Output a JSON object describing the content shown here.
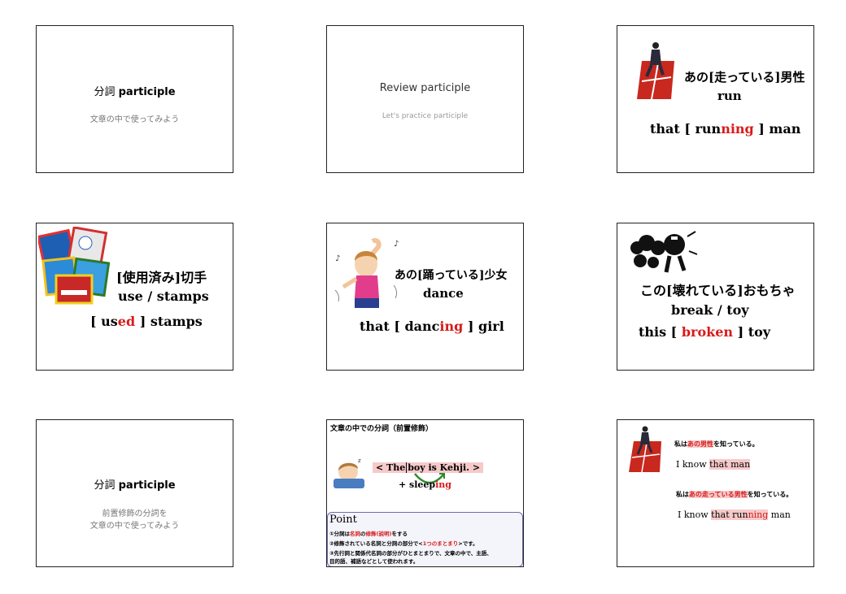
{
  "slides": {
    "s1": {
      "title_jp": "分詞",
      "title_en": "participle",
      "subtitle": "文章の中で使ってみよう"
    },
    "s2": {
      "title": "Review participle",
      "subtitle": "Let's practice participle"
    },
    "s3": {
      "jp": "あの[走っている]男性",
      "word": "run",
      "ph_a": "that [  run",
      "ph_b": "ning",
      "ph_c": "  ] man"
    },
    "s4": {
      "jp": "[使用済み]切手",
      "words": "use /  stamps",
      "ph_a": "[  us",
      "ph_b": "ed",
      "ph_c": "  ] stamps"
    },
    "s5": {
      "jp": "あの[踊っている]少女",
      "word": "dance",
      "ph_a": "that [  danc",
      "ph_b": "ing",
      "ph_c": "  ] girl"
    },
    "s6": {
      "jp": "この[壊れている]おもちゃ",
      "words": "break  / toy",
      "ph_a": "this [  ",
      "ph_b": "broken",
      "ph_c": "  ] toy"
    },
    "s7": {
      "title_jp": "分詞",
      "title_en": "participle",
      "sub1": "前置修飾の分詞を",
      "sub2": "文章の中で使ってみよう"
    },
    "s8": {
      "heading": "文章の中での分詞（前置修飾）",
      "sentence_a": "< The",
      "sentence_b": "boy   is Kehji.",
      "sentence_c": " >",
      "add_a": "+ sleep",
      "add_b": "ing",
      "point_title": "Point",
      "p1_a": "①分詞は",
      "p1_b": "名詞",
      "p1_c": "の",
      "p1_d": "修飾(説明)",
      "p1_e": "をする",
      "p2_a": "②修飾されている名詞と分詞の部分で<",
      "p2_b": "1つのまとまり",
      "p2_c": ">です。",
      "p3": "③先行詞と関係代名詞の部分がひとまとまりで、文章の中で、主語、",
      "p4": "  目的語、補語などとして使われます。"
    },
    "s9": {
      "l1_a": "私は",
      "l1_b": "あの男性",
      "l1_c": "を知っている。",
      "l2_a": "I know ",
      "l2_b": "that man",
      "l3_a": "私は",
      "l3_b": "あの走っている男性",
      "l3_c": "を知っている。",
      "l4_a": "I know ",
      "l4_b": "that run",
      "l4_c": "ning",
      "l4_d": " man"
    }
  }
}
